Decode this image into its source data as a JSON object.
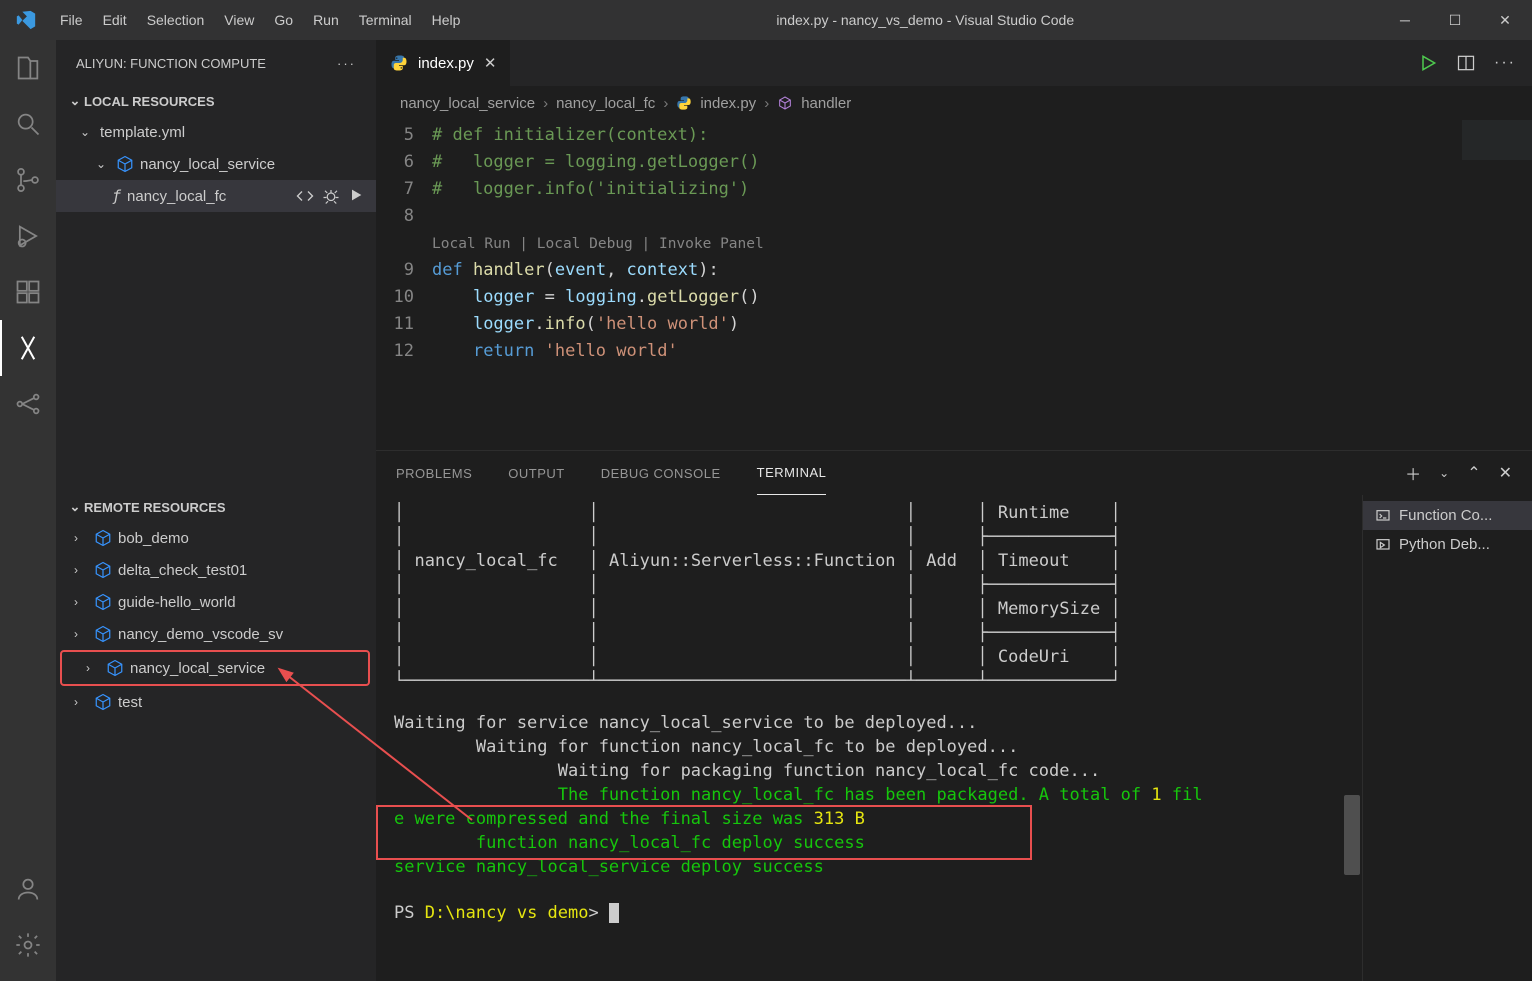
{
  "menu": {
    "file": "File",
    "edit": "Edit",
    "selection": "Selection",
    "view": "View",
    "go": "Go",
    "run": "Run",
    "terminal": "Terminal",
    "help": "Help"
  },
  "window_title": "index.py - nancy_vs_demo - Visual Studio Code",
  "sidebar": {
    "header": "ALIYUN: FUNCTION COMPUTE",
    "local_section": "LOCAL RESOURCES",
    "template_file": "template.yml",
    "service_name": "nancy_local_service",
    "function_name": "nancy_local_fc",
    "remote_section": "REMOTE RESOURCES",
    "remote_items": [
      "bob_demo",
      "delta_check_test01",
      "guide-hello_world",
      "nancy_demo_vscode_sv",
      "nancy_local_service",
      "test"
    ],
    "remote_highlight_index": 4
  },
  "tab": {
    "filename": "index.py"
  },
  "breadcrumb": {
    "a": "nancy_local_service",
    "b": "nancy_local_fc",
    "c": "index.py",
    "d": "handler"
  },
  "codelens": "Local Run | Local Debug | Invoke Panel",
  "code": {
    "l5": "# def initializer(context):",
    "l6": "#   logger = logging.getLogger()",
    "l7": "#   logger.info('initializing')",
    "l8": "",
    "l9_def": "def",
    "l9_fn": "handler",
    "l9_p1": "event",
    "l9_p2": "context",
    "l10_a": "logger",
    "l10_b": "logging",
    "l10_c": "getLogger",
    "l11_a": "logger",
    "l11_b": "info",
    "l11_s": "'hello world'",
    "l12_k": "return",
    "l12_s": "'hello world'"
  },
  "panel_tabs": {
    "problems": "PROBLEMS",
    "output": "OUTPUT",
    "debug": "DEBUG CONSOLE",
    "terminal": "TERMINAL"
  },
  "terminal": {
    "table": {
      "fn": "nancy_local_fc",
      "type": "Aliyun::Serverless::Function",
      "action": "Add",
      "metas": [
        "Runtime",
        "Timeout",
        "MemorySize",
        "CodeUri"
      ]
    },
    "log": {
      "l1": "Waiting for service nancy_local_service to be deployed...",
      "l2": "        Waiting for function nancy_local_fc to be deployed...",
      "l3": "                Waiting for packaging function nancy_local_fc code...",
      "l4a": "                The function nancy_local_fc has been packaged. A total of ",
      "l4b": "1",
      "l4c": " fil",
      "l5a": "e were compressed and the final size was ",
      "l5b": "313 B",
      "l6": "        function nancy_local_fc deploy success",
      "l7": "service nancy_local_service deploy success"
    },
    "prompt_a": "PS ",
    "prompt_b": "D:\\nancy vs demo",
    "prompt_c": ">"
  },
  "term_side": {
    "a": "Function Co...",
    "b": "Python Deb..."
  }
}
